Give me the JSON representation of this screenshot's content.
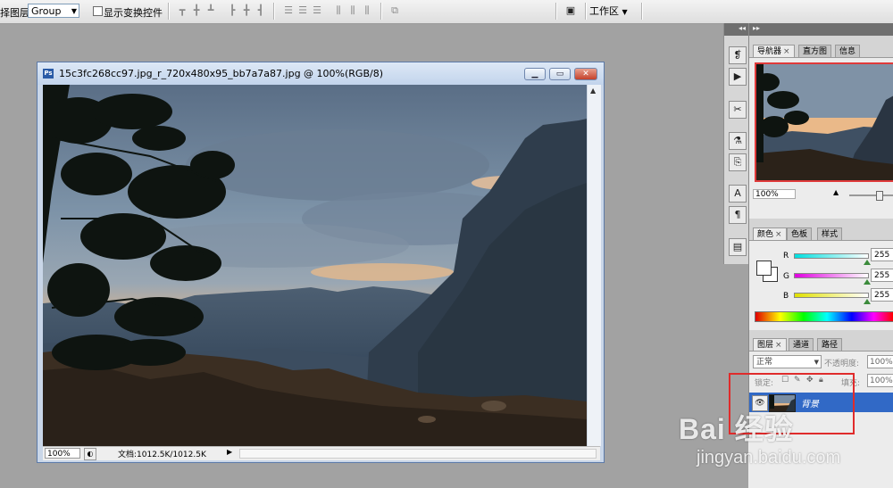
{
  "options_bar": {
    "auto_select_label": "择图层",
    "auto_select_value": "Group",
    "show_transform_label": "显示变换控件",
    "workspace_label": "工作区"
  },
  "document": {
    "title": "15c3fc268cc97.jpg_r_720x480x95_bb7a7a87.jpg @ 100%(RGB/8)",
    "zoom": "100%",
    "doc_size": "文档:1012.5K/1012.5K"
  },
  "panels": {
    "navigator": {
      "tabs": [
        "导航器",
        "直方图",
        "信息"
      ],
      "zoom": "100%"
    },
    "color": {
      "tabs": [
        "颜色",
        "色板",
        "样式"
      ],
      "channels": [
        {
          "label": "R",
          "value": "255",
          "level": 1.0,
          "gradient": "#00dede,#ffffff"
        },
        {
          "label": "G",
          "value": "255",
          "level": 1.0,
          "gradient": "#e000e0,#ffffff"
        },
        {
          "label": "B",
          "value": "255",
          "level": 1.0,
          "gradient": "#e0e000,#ffffff"
        }
      ]
    },
    "layers": {
      "tabs": [
        "图层",
        "通道",
        "路径"
      ],
      "blend_mode": "正常",
      "opacity_label": "不透明度:",
      "opacity_value": "100%",
      "lock_label": "锁定:",
      "fill_label": "填充:",
      "fill_value": "100%",
      "layer_name": "背景"
    }
  },
  "watermark": {
    "logo_text": "Bai 经验",
    "url": "jingyan.baidu.com"
  },
  "colors": {
    "accent_selection": "#3169c6",
    "highlight_red": "#e02b2b"
  }
}
